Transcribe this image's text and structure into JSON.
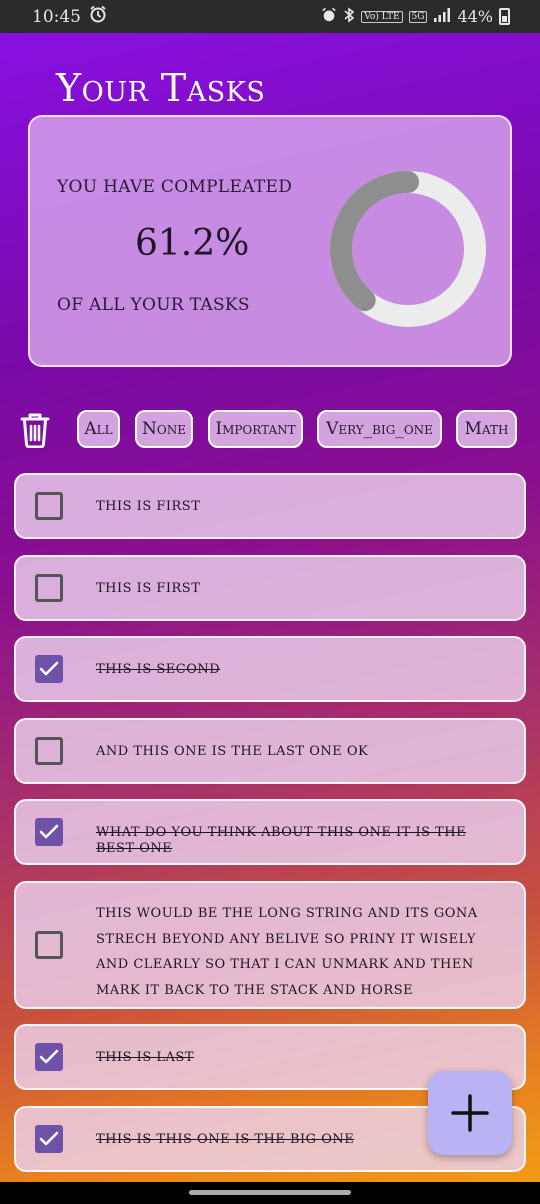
{
  "status": {
    "time": "10:45",
    "volte": "Vo) LTE",
    "net": "5G",
    "battery": "44%"
  },
  "header": {
    "title": "Your Tasks"
  },
  "summary": {
    "line1": "YOU HAVE COMPLEATED",
    "percent_text": "61.2%",
    "percent_value": 61.2,
    "line2": "OF ALL YOUR TASKS"
  },
  "filters": [
    "All",
    "None",
    "Important",
    "Very_big_one",
    "Math"
  ],
  "tasks": [
    {
      "text": "this is first",
      "done": false
    },
    {
      "text": "this is first",
      "done": false
    },
    {
      "text": "this is second",
      "done": true
    },
    {
      "text": "and this one is the last one ok",
      "done": false
    },
    {
      "text": "what do you think about this one it is the best one",
      "done": true
    },
    {
      "text": "this would be the long string and its gona strech beyond any belive so priny it wisely and clearly so that i can unmark and then mark it back to the stack and horse",
      "done": false
    },
    {
      "text": "this is last",
      "done": true
    },
    {
      "text": "this is this one is the big one",
      "done": true
    }
  ],
  "colors": {
    "checkbox": "#6e52a8",
    "fab": "#b9b3f3",
    "ring_track": "#ececec",
    "ring_progress": "#8e8e8e"
  }
}
